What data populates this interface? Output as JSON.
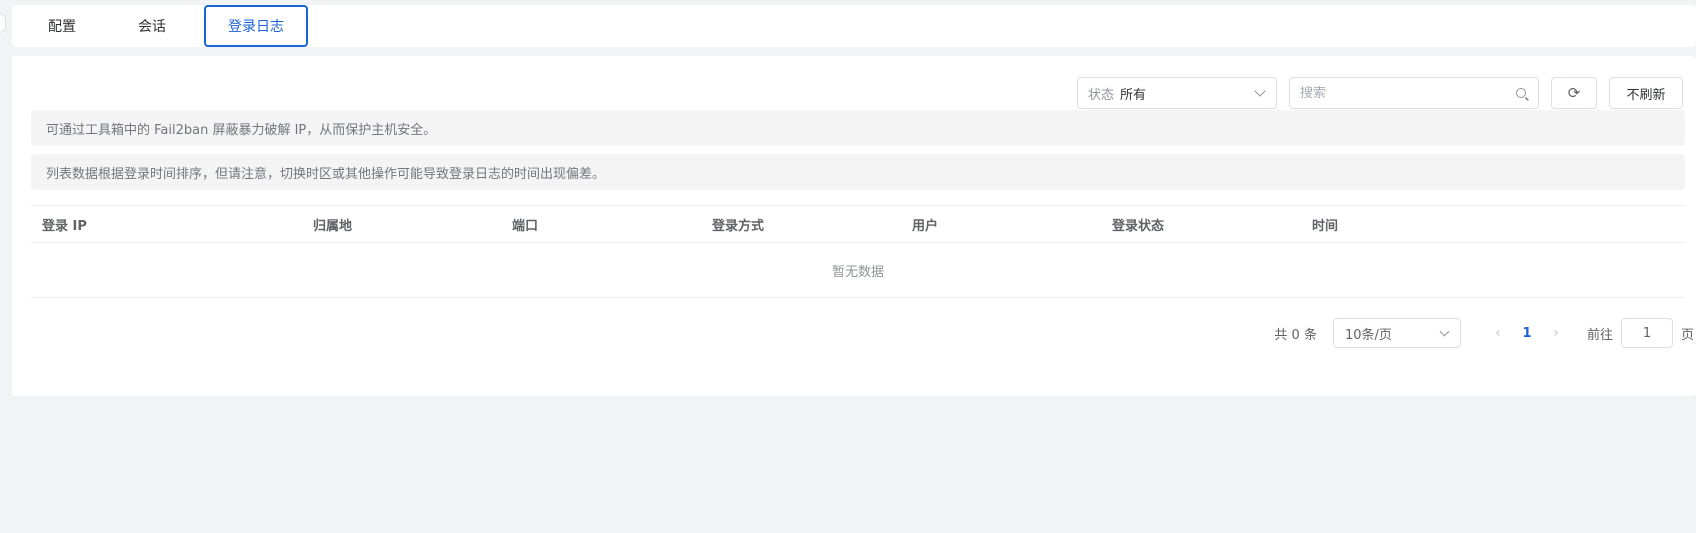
{
  "tabs": [
    {
      "label": "配置"
    },
    {
      "label": "会话"
    },
    {
      "label": "登录日志",
      "active": true
    }
  ],
  "toolbar": {
    "status_label": "状态",
    "status_value": "所有",
    "search_placeholder": "搜索",
    "refresh_icon": "⟳",
    "no_refresh_label": "不刷新"
  },
  "notices": [
    "可通过工具箱中的 Fail2ban 屏蔽暴力破解 IP，从而保护主机安全。",
    "列表数据根据登录时间排序，但请注意，切换时区或其他操作可能导致登录日志的时间出现偏差。"
  ],
  "table": {
    "columns": [
      "登录 IP",
      "归属地",
      "端口",
      "登录方式",
      "用户",
      "登录状态",
      "时间"
    ],
    "empty_text": "暂无数据"
  },
  "pagination": {
    "total": "共 0 条",
    "page_size": "10条/页",
    "prev": "‹",
    "current_page": "1",
    "next": "›",
    "goto_label": "前往",
    "goto_value": "1",
    "page_unit": "页"
  },
  "colors": {
    "accent": "#1c63d6",
    "background": "#f2f3f5",
    "notice_bg": "#f4f4f5"
  }
}
